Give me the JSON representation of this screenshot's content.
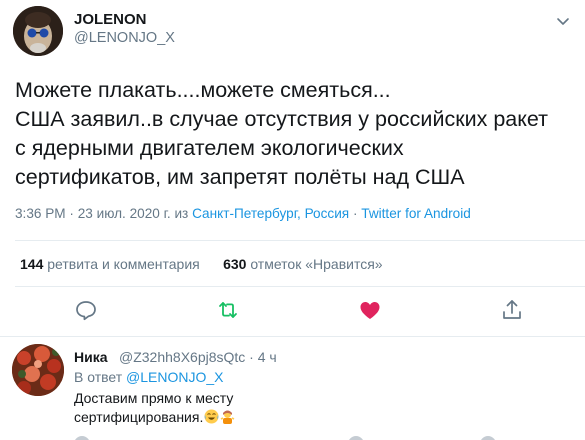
{
  "tweet": {
    "author_name": "JOLENON",
    "author_handle": "@LENONJO_X",
    "text_lines": [
      "Можете плакать....можете смеяться...",
      "США заявил..в случае отсутствия у российских ракет",
      "с ядерными двигателем экологических",
      "сертификатов, им запретят полёты над США"
    ],
    "time": "3:36 PM",
    "date": "23 июл. 2020 г.",
    "from_word": "из",
    "location": "Санкт-Петербург, Россия",
    "client": "Twitter for Android",
    "separator": "·"
  },
  "stats": {
    "retweets_count": "144",
    "retweets_label": "ретвита и комментария",
    "likes_count": "630",
    "likes_label": "отметок «Нравится»"
  },
  "actions": [
    {
      "name": "reply",
      "icon": "reply-icon"
    },
    {
      "name": "retweet",
      "icon": "retweet-icon",
      "color": "#17bf63"
    },
    {
      "name": "like",
      "icon": "heart-icon",
      "color": "#e0245e"
    },
    {
      "name": "share",
      "icon": "share-icon"
    }
  ],
  "reply": {
    "author_name": "Ника",
    "author_handle": "@Z32hh8X6pj8sQtc",
    "separator": "·",
    "time_ago": "4 ч",
    "in_reply_prefix": "В ответ",
    "in_reply_handle": "@LENONJO_X",
    "text_lines": [
      "Доставим прямо к месту",
      "сертифицирования."
    ],
    "emojis": [
      "face-with-tears-of-joy-icon",
      "person-shrugging-icon"
    ]
  },
  "colors": {
    "link": "#1b95e0",
    "secondary_text": "#657786",
    "retweet_green": "#17bf63",
    "like_red": "#e0245e"
  }
}
